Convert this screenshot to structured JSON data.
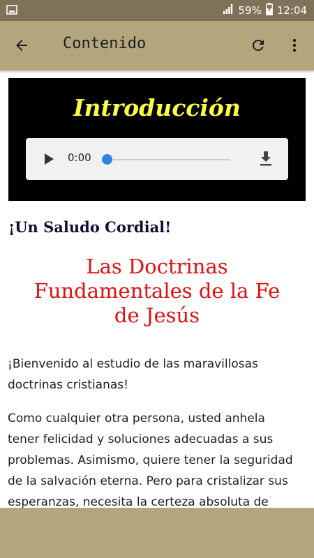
{
  "status_bar": {
    "battery": "59%",
    "time": "12:04"
  },
  "app_bar": {
    "title": "Contenido"
  },
  "banner": {
    "heading": "Introducción"
  },
  "audio_player": {
    "time": "0:00",
    "progress": 0
  },
  "content": {
    "greeting": "¡Un Saludo Cordial!",
    "title_lines": [
      "Las Doctrinas",
      "Fundamentales de la Fe",
      "de Jesús"
    ],
    "paragraph1_lines": [
      "¡Bienvenido al estudio de las maravillosas",
      "doctrinas cristianas!"
    ],
    "paragraph2_lines": [
      "Como cualquier otra persona, usted anhela",
      "tener felicidad y soluciones adecuadas a sus",
      "problemas. Asimismo, quiere tener la seguridad",
      "de la salvación eterna. Pero para cristalizar sus",
      "esperanzas, necesita la certeza absoluta de"
    ]
  },
  "colors": {
    "status_bar": "#7e7358",
    "app_bar": "#b3a67c",
    "banner_bg": "#000000",
    "heading": "#fefe43",
    "title": "#e01010",
    "greeting": "#101034",
    "audio_thumb": "#2f83e8"
  },
  "icons": {
    "status_left": "image-icon",
    "back": "arrow-left-icon",
    "refresh": "refresh-icon",
    "more": "more-vert-icon",
    "play": "play-icon",
    "download": "download-icon"
  }
}
